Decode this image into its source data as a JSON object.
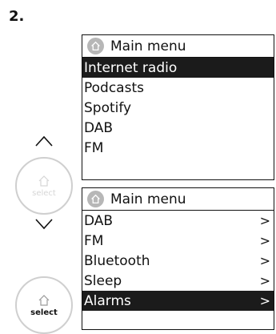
{
  "step_label": "2.",
  "top_screen": {
    "title": "Main menu",
    "items": [
      {
        "label": "Internet radio",
        "selected": true
      },
      {
        "label": "Podcasts",
        "selected": false
      },
      {
        "label": "Spotify",
        "selected": false
      },
      {
        "label": "DAB",
        "selected": false
      },
      {
        "label": "FM",
        "selected": false
      }
    ]
  },
  "bottom_screen": {
    "title": "Main menu",
    "items": [
      {
        "label": "DAB",
        "chevron": ">",
        "selected": false
      },
      {
        "label": "FM",
        "chevron": ">",
        "selected": false
      },
      {
        "label": "Bluetooth",
        "chevron": ">",
        "selected": false
      },
      {
        "label": "Sleep",
        "chevron": ">",
        "selected": false
      },
      {
        "label": "Alarms",
        "chevron": ">",
        "selected": true
      }
    ]
  },
  "knobs": {
    "top_label": "select",
    "bottom_label": "select"
  },
  "icons": {
    "home": "home-icon",
    "up": "chevron-up-icon",
    "down": "chevron-down-icon"
  },
  "colors": {
    "selected_bg": "#1b1b1b",
    "home_badge": "#b7b7b7",
    "knob_border": "#cfcfcf"
  }
}
